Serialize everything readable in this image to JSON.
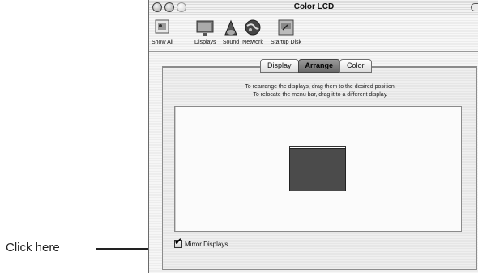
{
  "callout": {
    "text": "Click here"
  },
  "window": {
    "title": "Color LCD",
    "buttons": {
      "close": "close-button",
      "minimize": "minimize-button",
      "zoom": "zoom-button"
    }
  },
  "toolbar": {
    "items": [
      {
        "label": "Show All",
        "icon": "show-all-icon"
      },
      {
        "label": "Displays",
        "icon": "displays-icon"
      },
      {
        "label": "Sound",
        "icon": "sound-icon"
      },
      {
        "label": "Network",
        "icon": "network-icon"
      },
      {
        "label": "Startup Disk",
        "icon": "startup-disk-icon"
      }
    ]
  },
  "tabs": [
    {
      "label": "Display",
      "active": false
    },
    {
      "label": "Arrange",
      "active": true
    },
    {
      "label": "Color",
      "active": false
    }
  ],
  "arrange": {
    "instruction_line1": "To rearrange the displays, drag them to the desired position.",
    "instruction_line2": "To relocate the menu bar, drag it to a different display."
  },
  "mirror": {
    "label": "Mirror Displays",
    "checked": true
  },
  "colors": {
    "display_fill": "#4b4b4b",
    "active_tab": "#7a7a7a"
  }
}
